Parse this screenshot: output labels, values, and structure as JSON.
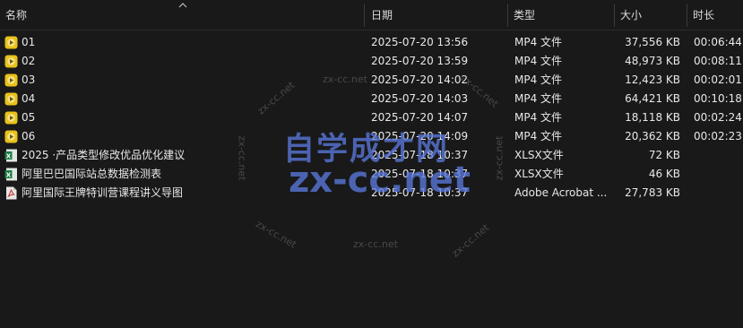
{
  "header": {
    "name": "名称",
    "date": "日期",
    "type": "类型",
    "size": "大小",
    "duration": "时长"
  },
  "files": [
    {
      "name": "01",
      "date": "2025-07-20 13:56",
      "type": "MP4 文件",
      "size": "37,556 KB",
      "duration": "00:06:44",
      "icon": "video-file-icon"
    },
    {
      "name": "02",
      "date": "2025-07-20 13:59",
      "type": "MP4 文件",
      "size": "48,973 KB",
      "duration": "00:08:11",
      "icon": "video-file-icon"
    },
    {
      "name": "03",
      "date": "2025-07-20 14:02",
      "type": "MP4 文件",
      "size": "12,423 KB",
      "duration": "00:02:01",
      "icon": "video-file-icon"
    },
    {
      "name": "04",
      "date": "2025-07-20 14:03",
      "type": "MP4 文件",
      "size": "64,421 KB",
      "duration": "00:10:18",
      "icon": "video-file-icon"
    },
    {
      "name": "05",
      "date": "2025-07-20 14:07",
      "type": "MP4 文件",
      "size": "18,118 KB",
      "duration": "00:02:24",
      "icon": "video-file-icon"
    },
    {
      "name": "06",
      "date": "2025-07-20 14:09",
      "type": "MP4 文件",
      "size": "20,362 KB",
      "duration": "00:02:23",
      "icon": "video-file-icon"
    },
    {
      "name": "2025 ·产品类型修改优品优化建议",
      "date": "2025-07-18 10:37",
      "type": "XLSX文件",
      "size": "72 KB",
      "duration": "",
      "icon": "excel-file-icon"
    },
    {
      "name": "阿里巴巴国际站总数据检测表",
      "date": "2025-07-18 10:37",
      "type": "XLSX文件",
      "size": "46 KB",
      "duration": "",
      "icon": "excel-file-icon"
    },
    {
      "name": "阿里国际王牌特训营课程讲义导图",
      "date": "2025-07-18 10:37",
      "type": "Adobe Acrobat ...",
      "size": "27,783 KB",
      "duration": "",
      "icon": "pdf-file-icon"
    }
  ],
  "watermark": {
    "main_cn": "自学成才网",
    "main_en": "zx-cc.net",
    "small": "zx-cc.net"
  },
  "colors": {
    "background": "#191919",
    "video_icon": "#e8c21a",
    "excel_icon": "#1e7b45",
    "pdf_icon": "#d8d8d8",
    "watermark_blue": "#5a78dc"
  }
}
